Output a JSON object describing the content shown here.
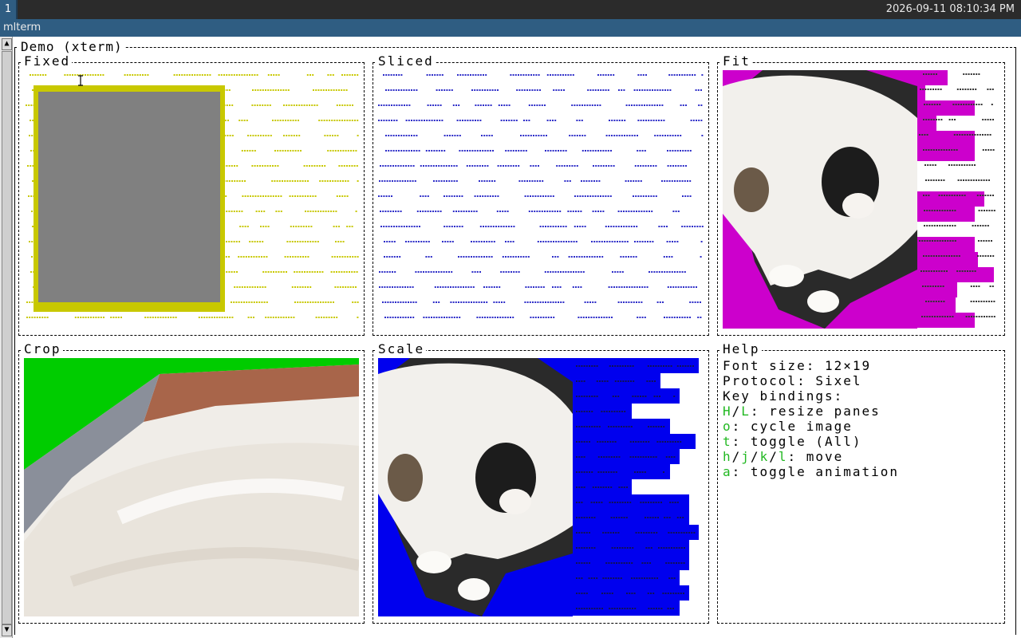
{
  "taskbar": {
    "workspace": "1",
    "clock": "2026-09-11 08:10:34 PM"
  },
  "window": {
    "title": "mlterm"
  },
  "demo": {
    "title": "Demo (xterm)",
    "panes": {
      "fixed": "Fixed",
      "sliced": "Sliced",
      "fit": "Fit",
      "crop": "Crop",
      "scale": "Scale",
      "help": "Help"
    }
  },
  "help": {
    "font_size": "Font size: 12×19",
    "protocol": "Protocol: Sixel",
    "key_bindings": "Key bindings:",
    "bindings": [
      {
        "keys": [
          "H",
          "L"
        ],
        "desc": ": resize panes"
      },
      {
        "keys": [
          "o"
        ],
        "desc": ": cycle image"
      },
      {
        "keys": [
          "t"
        ],
        "desc": ": toggle (All)"
      },
      {
        "keys": [
          "h",
          "j",
          "k",
          "l"
        ],
        "desc": ": move"
      },
      {
        "keys": [
          "a"
        ],
        "desc": ": toggle animation"
      }
    ]
  },
  "colors": {
    "fixed_dots": "#c8c800",
    "fixed_frame": "#c8c800",
    "fixed_fill": "#808080",
    "sliced_dots": "#2d2dc8",
    "fit_background": "#cc00cc",
    "crop_background": "#00cc00",
    "scale_background": "#0000ee",
    "key_highlight": "#22b822"
  }
}
